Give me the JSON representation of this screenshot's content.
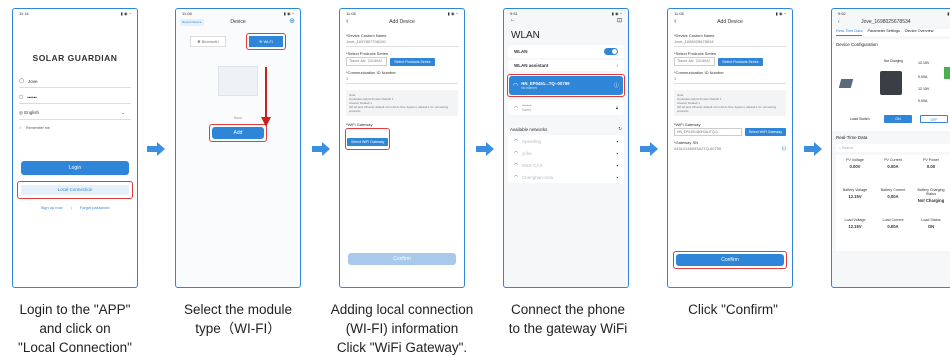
{
  "screen1": {
    "time": "11:16",
    "brand": "SOLAR GUARDIAN",
    "username": "Jove",
    "password": "••••••",
    "language": "English",
    "remember": "Remember me",
    "login": "Login",
    "local": "Local Connection",
    "signup": "Sign up now",
    "divider": "|",
    "forgot": "Forgot password"
  },
  "screen2": {
    "time": "11:08",
    "title": "Device",
    "top_left": "Recent Device",
    "bluetooth": "Bluetooth",
    "wifi": "Wi-Fi",
    "none": "None",
    "add": "Add"
  },
  "screen3": {
    "time": "11:08",
    "title": "Add Device",
    "f1": "*Device Custom Name",
    "f1v": "Jove_1697807708100",
    "f2": "*Select Products Series",
    "f2v": "Tracer-AN（10-60A）",
    "f2btn": "Select Products Series",
    "f3": "*Communication ID Number",
    "f3v": "1",
    "note": "Note\nController,Hybrid Power Default 1\nInverter Default 1\nUP-HI and UPower default 10 in All-in-One System; default 1 for remaining products",
    "f4": "*WiFi Gateway",
    "f4btn": "Select WiFi Gateway",
    "confirm": "Confirm"
  },
  "screen4": {
    "time": "9:51",
    "title": "WLAN",
    "wlan": "WLAN",
    "assistant": "WLAN assistant",
    "net1": "HN_EP0451...TQ--00759",
    "net1sub": "No internet",
    "net2": "••••••",
    "net2sub": "Saved",
    "avail": "Available networks",
    "others": [
      "Speeding",
      "yufei",
      "MSS-CAS",
      "Chenghan-slow"
    ]
  },
  "screen5": {
    "time": "11:08",
    "title": "Add Device",
    "f1": "*Device Custom Name",
    "f1v": "Jove_1698025678534",
    "f2": "*Select Products Series",
    "f2v": "Tracer-AN（10-60A）",
    "f2btn": "Select Products Series",
    "f3": "*Communication ID Number",
    "f3v": "1",
    "note": "Note\nController,Hybrid Power Default 1\nInverter Default 1\nUP-HI and UPower default 10 in All-in-One System; default 1 for remaining products",
    "f4": "*WiFi Gateway",
    "f4v": "HN_EP0451460H3AJTQ-0...",
    "f4btn": "Select WiFi Gateway",
    "f5": "*Gateway SN",
    "f5v": "04510146093AJTQ-00759",
    "confirm": "Confirm"
  },
  "screen6": {
    "time": "9:52",
    "title": "Jove_1698025678534",
    "tabs": [
      "Real-Time Data",
      "Parameter Settings",
      "Device Overview"
    ],
    "config": "Device Configuration",
    "charging": "Not Charging",
    "v1": "12.15V",
    "a1": "0.00A",
    "v2": "12.15V",
    "a2": "0.00A",
    "loadswitch": "Load Switch",
    "on": "ON",
    "off": "OFF",
    "rtd": "Real-Time Data",
    "search": "Search",
    "cells": [
      [
        "PV Voltage",
        "0.00V"
      ],
      [
        "PV Current",
        "0.00A"
      ],
      [
        "PV Power",
        "0.00"
      ],
      [
        "Battery Voltage",
        "12.15V"
      ],
      [
        "Battery Current",
        "0.00A"
      ],
      [
        "Battery Charging Status",
        "Not Charging"
      ],
      [
        "Load Voltage",
        "12.15V"
      ],
      [
        "Load Current",
        "0.00A"
      ],
      [
        "Load Status",
        "ON"
      ]
    ]
  },
  "captions": [
    [
      "Login to the \"APP\"",
      "and click on",
      "\"Local Connection\""
    ],
    [
      "Select the module",
      "type（WI-FI）"
    ],
    [
      "Adding local connection",
      "(WI-FI) information",
      "Click \"WiFi Gateway\"."
    ],
    [
      "Connect the phone",
      "to the gateway WiFi"
    ],
    [
      "Click \"Confirm\""
    ]
  ],
  "colors": {
    "accent": "#2f86d8",
    "highlight": "#e23d3d",
    "arrow": "#3a8fe0"
  }
}
